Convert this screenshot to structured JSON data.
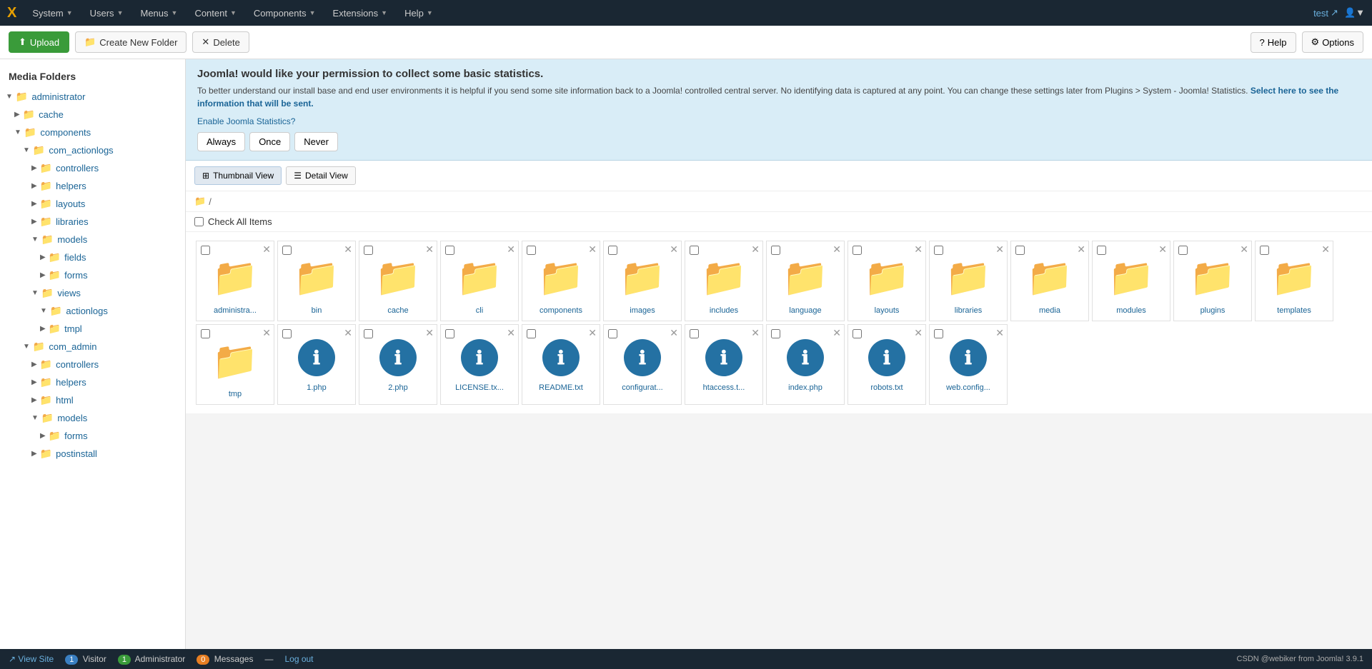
{
  "topnav": {
    "logo": "X",
    "items": [
      {
        "label": "System",
        "id": "system"
      },
      {
        "label": "Users",
        "id": "users"
      },
      {
        "label": "Menus",
        "id": "menus"
      },
      {
        "label": "Content",
        "id": "content"
      },
      {
        "label": "Components",
        "id": "components"
      },
      {
        "label": "Extensions",
        "id": "extensions"
      },
      {
        "label": "Help",
        "id": "help"
      }
    ],
    "user": "test",
    "user_icon": "↗"
  },
  "toolbar": {
    "upload_label": "Upload",
    "create_folder_label": "Create New Folder",
    "delete_label": "Delete",
    "help_label": "Help",
    "options_label": "Options"
  },
  "sidebar": {
    "title": "Media Folders",
    "tree": [
      {
        "label": "administrator",
        "level": 0,
        "expanded": true,
        "type": "folder"
      },
      {
        "label": "cache",
        "level": 1,
        "expanded": false,
        "type": "folder"
      },
      {
        "label": "components",
        "level": 1,
        "expanded": true,
        "type": "folder"
      },
      {
        "label": "com_actionlogs",
        "level": 2,
        "expanded": true,
        "type": "folder"
      },
      {
        "label": "controllers",
        "level": 3,
        "expanded": false,
        "type": "folder"
      },
      {
        "label": "helpers",
        "level": 3,
        "expanded": false,
        "type": "folder"
      },
      {
        "label": "layouts",
        "level": 3,
        "expanded": false,
        "type": "folder"
      },
      {
        "label": "libraries",
        "level": 3,
        "expanded": false,
        "type": "folder"
      },
      {
        "label": "models",
        "level": 3,
        "expanded": true,
        "type": "folder"
      },
      {
        "label": "fields",
        "level": 4,
        "expanded": false,
        "type": "folder"
      },
      {
        "label": "forms",
        "level": 4,
        "expanded": false,
        "type": "folder"
      },
      {
        "label": "views",
        "level": 3,
        "expanded": true,
        "type": "folder"
      },
      {
        "label": "actionlogs",
        "level": 4,
        "expanded": true,
        "type": "folder"
      },
      {
        "label": "tmpl",
        "level": 5,
        "expanded": false,
        "type": "folder"
      },
      {
        "label": "com_admin",
        "level": 2,
        "expanded": true,
        "type": "folder"
      },
      {
        "label": "controllers",
        "level": 3,
        "expanded": false,
        "type": "folder"
      },
      {
        "label": "helpers",
        "level": 3,
        "expanded": false,
        "type": "folder"
      },
      {
        "label": "html",
        "level": 3,
        "expanded": false,
        "type": "folder"
      },
      {
        "label": "models",
        "level": 3,
        "expanded": false,
        "type": "folder"
      },
      {
        "label": "forms",
        "level": 4,
        "expanded": false,
        "type": "folder"
      },
      {
        "label": "postinstall",
        "level": 3,
        "expanded": false,
        "type": "folder"
      }
    ]
  },
  "stats_banner": {
    "heading": "Joomla! would like your permission to collect some basic statistics.",
    "body": "To better understand our install base and end user environments it is helpful if you send some site information back to a Joomla! controlled central server. No identifying data is captured at any point. You can change these settings later from Plugins > System - Joomla! Statistics.",
    "select_link": "Select here to see the information that will be sent.",
    "enable_label": "Enable Joomla Statistics?",
    "btn_always": "Always",
    "btn_once": "Once",
    "btn_never": "Never"
  },
  "view_controls": {
    "thumbnail_label": "Thumbnail View",
    "detail_label": "Detail View"
  },
  "breadcrumb": {
    "path": "/"
  },
  "check_all": {
    "label": "Check All Items"
  },
  "grid_items": [
    {
      "name": "administra...",
      "type": "folder"
    },
    {
      "name": "bin",
      "type": "folder"
    },
    {
      "name": "cache",
      "type": "folder"
    },
    {
      "name": "cli",
      "type": "folder"
    },
    {
      "name": "components",
      "type": "folder"
    },
    {
      "name": "images",
      "type": "folder"
    },
    {
      "name": "includes",
      "type": "folder"
    },
    {
      "name": "language",
      "type": "folder"
    },
    {
      "name": "layouts",
      "type": "folder"
    },
    {
      "name": "libraries",
      "type": "folder"
    },
    {
      "name": "media",
      "type": "folder"
    },
    {
      "name": "modules",
      "type": "folder"
    },
    {
      "name": "plugins",
      "type": "folder"
    },
    {
      "name": "templates",
      "type": "folder"
    },
    {
      "name": "tmp",
      "type": "folder"
    },
    {
      "name": "1.php",
      "type": "file"
    },
    {
      "name": "2.php",
      "type": "file"
    },
    {
      "name": "LICENSE.tx...",
      "type": "file"
    },
    {
      "name": "README.txt",
      "type": "file"
    },
    {
      "name": "configurat...",
      "type": "file"
    },
    {
      "name": "htaccess.t...",
      "type": "file"
    },
    {
      "name": "index.php",
      "type": "file"
    },
    {
      "name": "robots.txt",
      "type": "file"
    },
    {
      "name": "web.config...",
      "type": "file"
    }
  ],
  "status_bar": {
    "view_site_label": "View Site",
    "visitor_label": "Visitor",
    "visitor_count": "1",
    "admin_label": "Administrator",
    "admin_count": "1",
    "messages_label": "Messages",
    "messages_count": "0",
    "logout_label": "Log out",
    "footer_text": "CSDN @webiker from Joomla! 3.9.1"
  }
}
